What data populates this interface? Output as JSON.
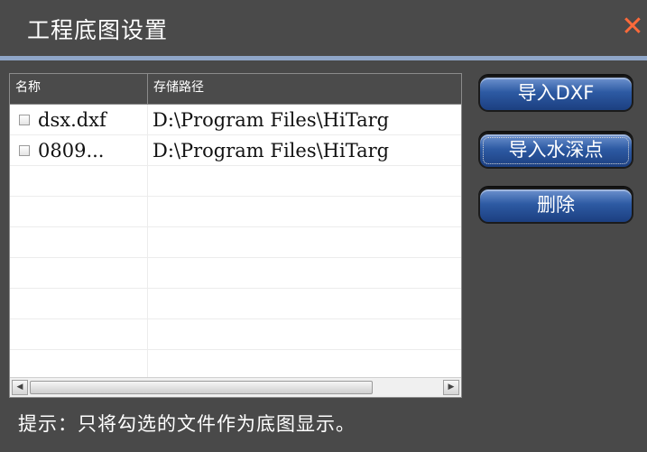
{
  "window": {
    "title": "工程底图设置",
    "close_glyph": "✕",
    "accent_color": "#8fa6c8",
    "close_color": "#ff6a3a"
  },
  "table": {
    "columns": [
      "名称",
      "存储路径"
    ],
    "rows": [
      {
        "checked": false,
        "name": "dsx.dxf",
        "path": "D:\\Program Files\\HiTarg"
      },
      {
        "checked": false,
        "name": "0809...",
        "path": "D:\\Program Files\\HiTarg"
      }
    ],
    "empty_rows": 7
  },
  "buttons": {
    "import_dxf": "导入DXF",
    "import_depth_points": "导入水深点",
    "delete": "删除"
  },
  "hint": "提示：只将勾选的文件作为底图显示。",
  "scrollbar": {
    "left_arrow": "◀",
    "right_arrow": "▶"
  }
}
